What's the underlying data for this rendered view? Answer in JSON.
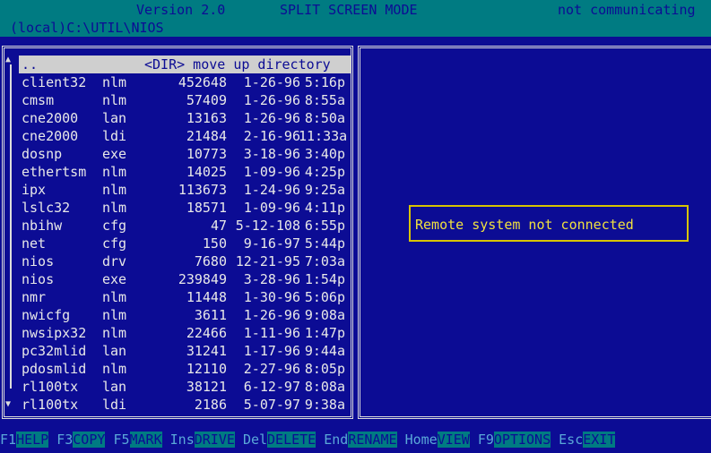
{
  "header": {
    "version": "Version 2.0",
    "mode": "SPLIT SCREEN MODE",
    "status": "not communicating",
    "path": "(local)C:\\UTIL\\NIOS"
  },
  "left_pane": {
    "up_entry": {
      "name": "..",
      "label": "<DIR> move up directory"
    },
    "files": [
      {
        "name": "client32",
        "ext": "nlm",
        "size": "452648",
        "date": "1-26-96",
        "time": "5:16p"
      },
      {
        "name": "cmsm",
        "ext": "nlm",
        "size": "57409",
        "date": "1-26-96",
        "time": "8:55a"
      },
      {
        "name": "cne2000",
        "ext": "lan",
        "size": "13163",
        "date": "1-26-96",
        "time": "8:50a"
      },
      {
        "name": "cne2000",
        "ext": "ldi",
        "size": "21484",
        "date": "2-16-96",
        "time": "11:33a"
      },
      {
        "name": "dosnp",
        "ext": "exe",
        "size": "10773",
        "date": "3-18-96",
        "time": "3:40p"
      },
      {
        "name": "ethertsm",
        "ext": "nlm",
        "size": "14025",
        "date": "1-09-96",
        "time": "4:25p"
      },
      {
        "name": "ipx",
        "ext": "nlm",
        "size": "113673",
        "date": "1-24-96",
        "time": "9:25a"
      },
      {
        "name": "lslc32",
        "ext": "nlm",
        "size": "18571",
        "date": "1-09-96",
        "time": "4:11p"
      },
      {
        "name": "nbihw",
        "ext": "cfg",
        "size": "47",
        "date": "5-12-108",
        "time": "6:55p"
      },
      {
        "name": "net",
        "ext": "cfg",
        "size": "150",
        "date": "9-16-97",
        "time": "5:44p"
      },
      {
        "name": "nios",
        "ext": "drv",
        "size": "7680",
        "date": "12-21-95",
        "time": "7:03a"
      },
      {
        "name": "nios",
        "ext": "exe",
        "size": "239849",
        "date": "3-28-96",
        "time": "1:54p"
      },
      {
        "name": "nmr",
        "ext": "nlm",
        "size": "11448",
        "date": "1-30-96",
        "time": "5:06p"
      },
      {
        "name": "nwicfg",
        "ext": "nlm",
        "size": "3611",
        "date": "1-26-96",
        "time": "9:08a"
      },
      {
        "name": "nwsipx32",
        "ext": "nlm",
        "size": "22466",
        "date": "1-11-96",
        "time": "1:47p"
      },
      {
        "name": "pc32mlid",
        "ext": "lan",
        "size": "31241",
        "date": "1-17-96",
        "time": "9:44a"
      },
      {
        "name": "pdosmlid",
        "ext": "nlm",
        "size": "12110",
        "date": "2-27-96",
        "time": "8:05p"
      },
      {
        "name": "rl100tx",
        "ext": "lan",
        "size": "38121",
        "date": "6-12-97",
        "time": "8:08a"
      },
      {
        "name": "rl100tx",
        "ext": "ldi",
        "size": "2186",
        "date": "5-07-97",
        "time": "9:38a"
      }
    ]
  },
  "right_pane": {
    "message": "Remote system not connected"
  },
  "function_keys": [
    {
      "key": "F1",
      "label": "HELP"
    },
    {
      "key": "F3",
      "label": "COPY"
    },
    {
      "key": "F5",
      "label": "MARK"
    },
    {
      "key": "Ins",
      "label": "DRIVE"
    },
    {
      "key": "Del",
      "label": "DELETE"
    },
    {
      "key": "End",
      "label": "RENAME"
    },
    {
      "key": "Home",
      "label": "VIEW"
    },
    {
      "key": "F9",
      "label": "OPTIONS"
    },
    {
      "key": "Esc",
      "label": "EXIT"
    }
  ],
  "icons": {
    "scroll_up": "arrow-up-icon",
    "scroll_down": "arrow-down-icon"
  },
  "colors": {
    "background": "#0c0c94",
    "header": "#007b82",
    "selection": "#cfcfcf",
    "message": "#f0e040",
    "key": "#5aa8d8"
  }
}
